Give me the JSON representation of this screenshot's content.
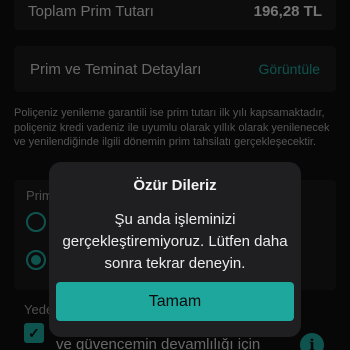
{
  "background": {
    "premium_label": "Toplam Prim Tutarı",
    "premium_amount": "196,28 TL",
    "detail_card_label": "Prim ve Teminat Detayları",
    "detail_card_link": "Görüntüle",
    "info_text": "Poliçeniz yenileme garantili ise prim tutarı ilk yılı kapsamaktadır, poliçeniz kredi vadeniz ile uyumlu olarak yıllık olarak yenilenecek ve yenilendiğinde ilgili dönemin prim tahsilatı gerçekleşecektir.",
    "section_title": "Prim",
    "extension_label": "Yede",
    "extension_text": "ve güvencemin devamlılığı için"
  },
  "dialog": {
    "title": "Özür Dileriz",
    "message": "Şu anda işleminizi gerçekleştiremiyoruz. Lütfen daha sonra tekrar deneyin.",
    "button_label": "Tamam"
  },
  "colors": {
    "accent": "#1ea79c",
    "dialog_bg": "#1f1f22",
    "page_bg": "#0e0e10"
  },
  "icons": {
    "checkbox": "check-icon",
    "info": "info-icon"
  }
}
